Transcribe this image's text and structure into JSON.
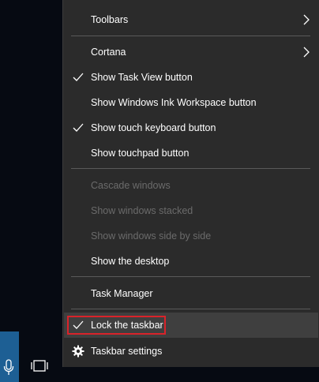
{
  "menu": {
    "items": [
      {
        "label": "Toolbars",
        "checked": false,
        "submenu": true,
        "disabled": false
      },
      {
        "label": "Cortana",
        "checked": false,
        "submenu": true,
        "disabled": false
      },
      {
        "label": "Show Task View button",
        "checked": true,
        "submenu": false,
        "disabled": false
      },
      {
        "label": "Show Windows Ink Workspace button",
        "checked": false,
        "submenu": false,
        "disabled": false
      },
      {
        "label": "Show touch keyboard button",
        "checked": true,
        "submenu": false,
        "disabled": false
      },
      {
        "label": "Show touchpad button",
        "checked": false,
        "submenu": false,
        "disabled": false
      },
      {
        "label": "Cascade windows",
        "checked": false,
        "submenu": false,
        "disabled": true
      },
      {
        "label": "Show windows stacked",
        "checked": false,
        "submenu": false,
        "disabled": true
      },
      {
        "label": "Show windows side by side",
        "checked": false,
        "submenu": false,
        "disabled": true
      },
      {
        "label": "Show the desktop",
        "checked": false,
        "submenu": false,
        "disabled": false
      },
      {
        "label": "Task Manager",
        "checked": false,
        "submenu": false,
        "disabled": false
      },
      {
        "label": "Lock the taskbar",
        "checked": true,
        "submenu": false,
        "disabled": false,
        "highlighted": true
      },
      {
        "label": "Taskbar settings",
        "checked": false,
        "submenu": false,
        "disabled": false,
        "icon": "gear-icon"
      }
    ]
  },
  "taskbar": {
    "icons": [
      "microphone-icon",
      "task-view-icon"
    ]
  },
  "colors": {
    "menu_bg": "#2b2b2b",
    "highlight_border": "#d9232a",
    "taskbar_accent": "#1d5f94",
    "disabled_text": "#6b6b6b"
  }
}
